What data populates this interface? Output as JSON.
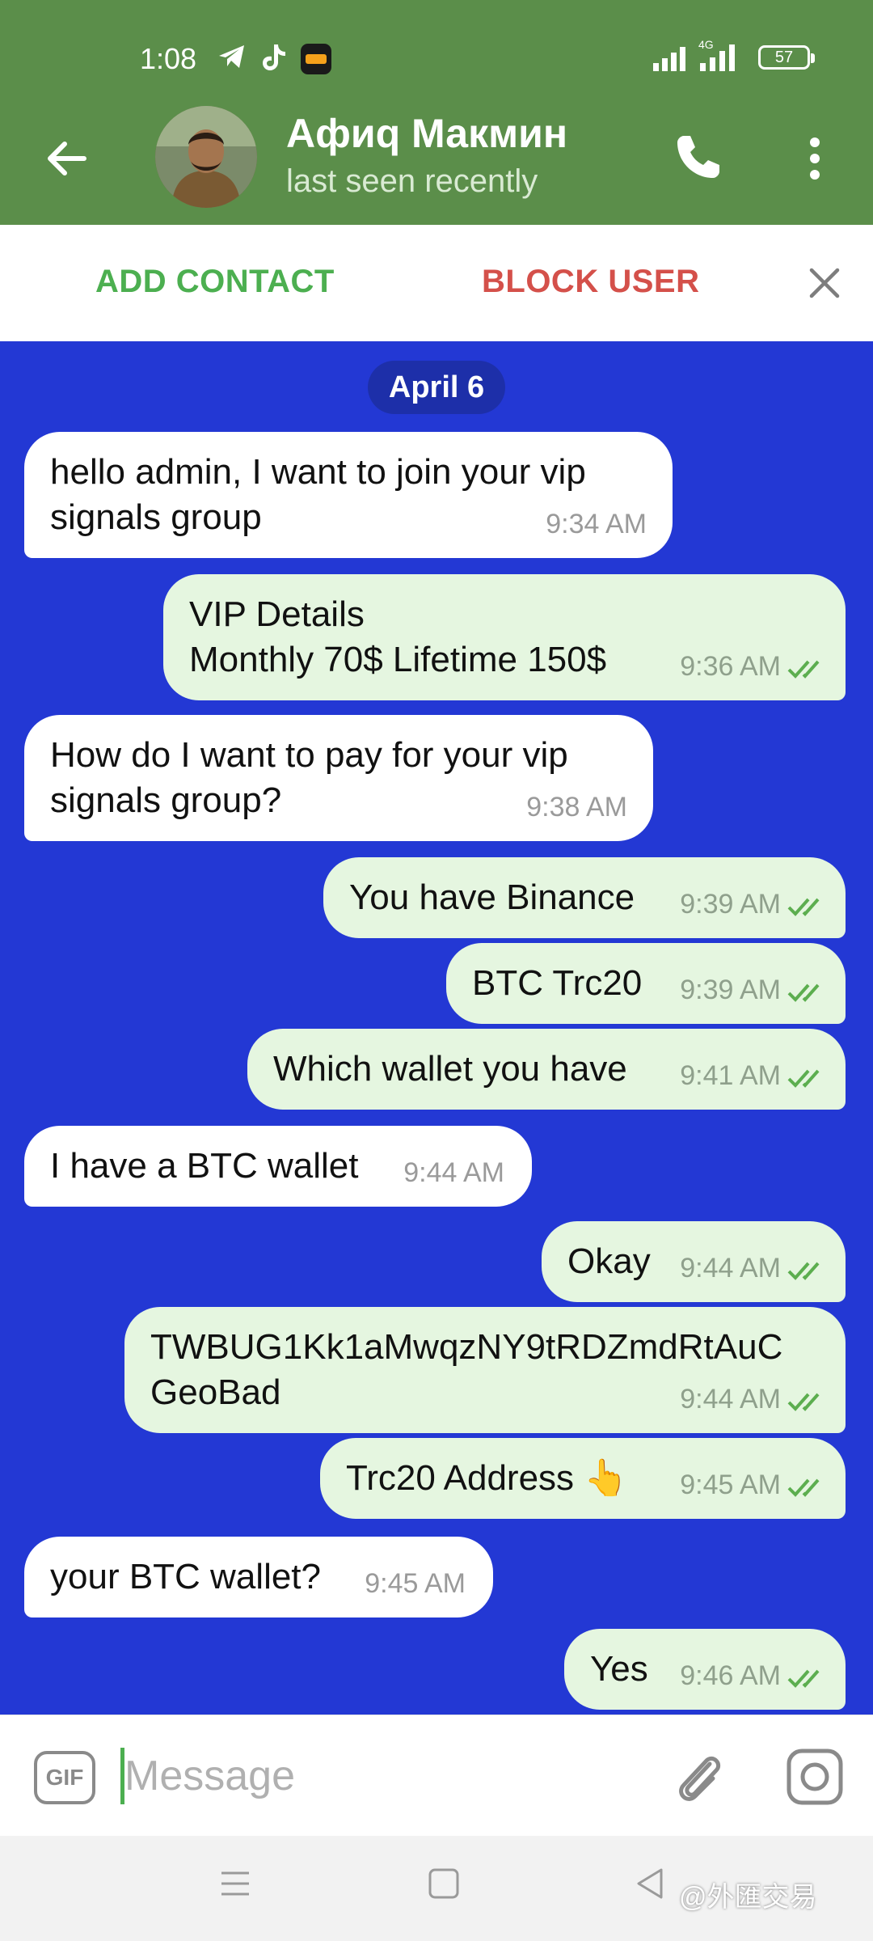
{
  "status_bar": {
    "time": "1:08",
    "battery": "57",
    "network": "4G"
  },
  "header": {
    "contact_name": "Афиq Макмин",
    "status": "last seen recently",
    "icons": [
      "back-arrow-icon",
      "phone-icon",
      "more-vert-icon"
    ]
  },
  "action_bar": {
    "add_contact": "ADD CONTACT",
    "block_user": "BLOCK USER"
  },
  "chat": {
    "date": "April 6",
    "messages": [
      {
        "dir": "in",
        "line1": "hello admin, I want to join your vip",
        "line2": "signals group",
        "time": "9:34 AM"
      },
      {
        "dir": "out",
        "line1": "VIP Details",
        "line2": "Monthly 70$ Lifetime 150$",
        "time": "9:36 AM"
      },
      {
        "dir": "in",
        "line1": "How do I want to pay for your vip",
        "line2": "signals group?",
        "time": "9:38 AM"
      },
      {
        "dir": "out",
        "text": "You have Binance",
        "time": "9:39 AM"
      },
      {
        "dir": "out",
        "text": "BTC Trc20",
        "time": "9:39 AM"
      },
      {
        "dir": "out",
        "text": "Which wallet you have",
        "time": "9:41 AM"
      },
      {
        "dir": "in",
        "text": "I have a BTC wallet",
        "time": "9:44 AM"
      },
      {
        "dir": "out",
        "text": "Okay",
        "time": "9:44 AM"
      },
      {
        "dir": "out",
        "line1": "TWBUG1Kk1aMwqzNY9tRDZmdRtAuC",
        "line2": "GeoBad",
        "time": "9:44 AM"
      },
      {
        "dir": "out",
        "text": "Trc20 Address 👆",
        "time": "9:45 AM"
      },
      {
        "dir": "in",
        "text": "your BTC wallet?",
        "time": "9:45 AM"
      },
      {
        "dir": "out",
        "text": "Yes",
        "time": "9:46 AM"
      }
    ]
  },
  "composer": {
    "gif_label": "GIF",
    "placeholder": "Message"
  },
  "watermark": "@外匯交易",
  "colors": {
    "header": "#5b8e4a",
    "chat_bg": "#2338d4",
    "out_bubble": "#e5f6e0",
    "in_bubble": "#ffffff",
    "add_contact": "#4caf50",
    "block_user": "#d4504a"
  }
}
